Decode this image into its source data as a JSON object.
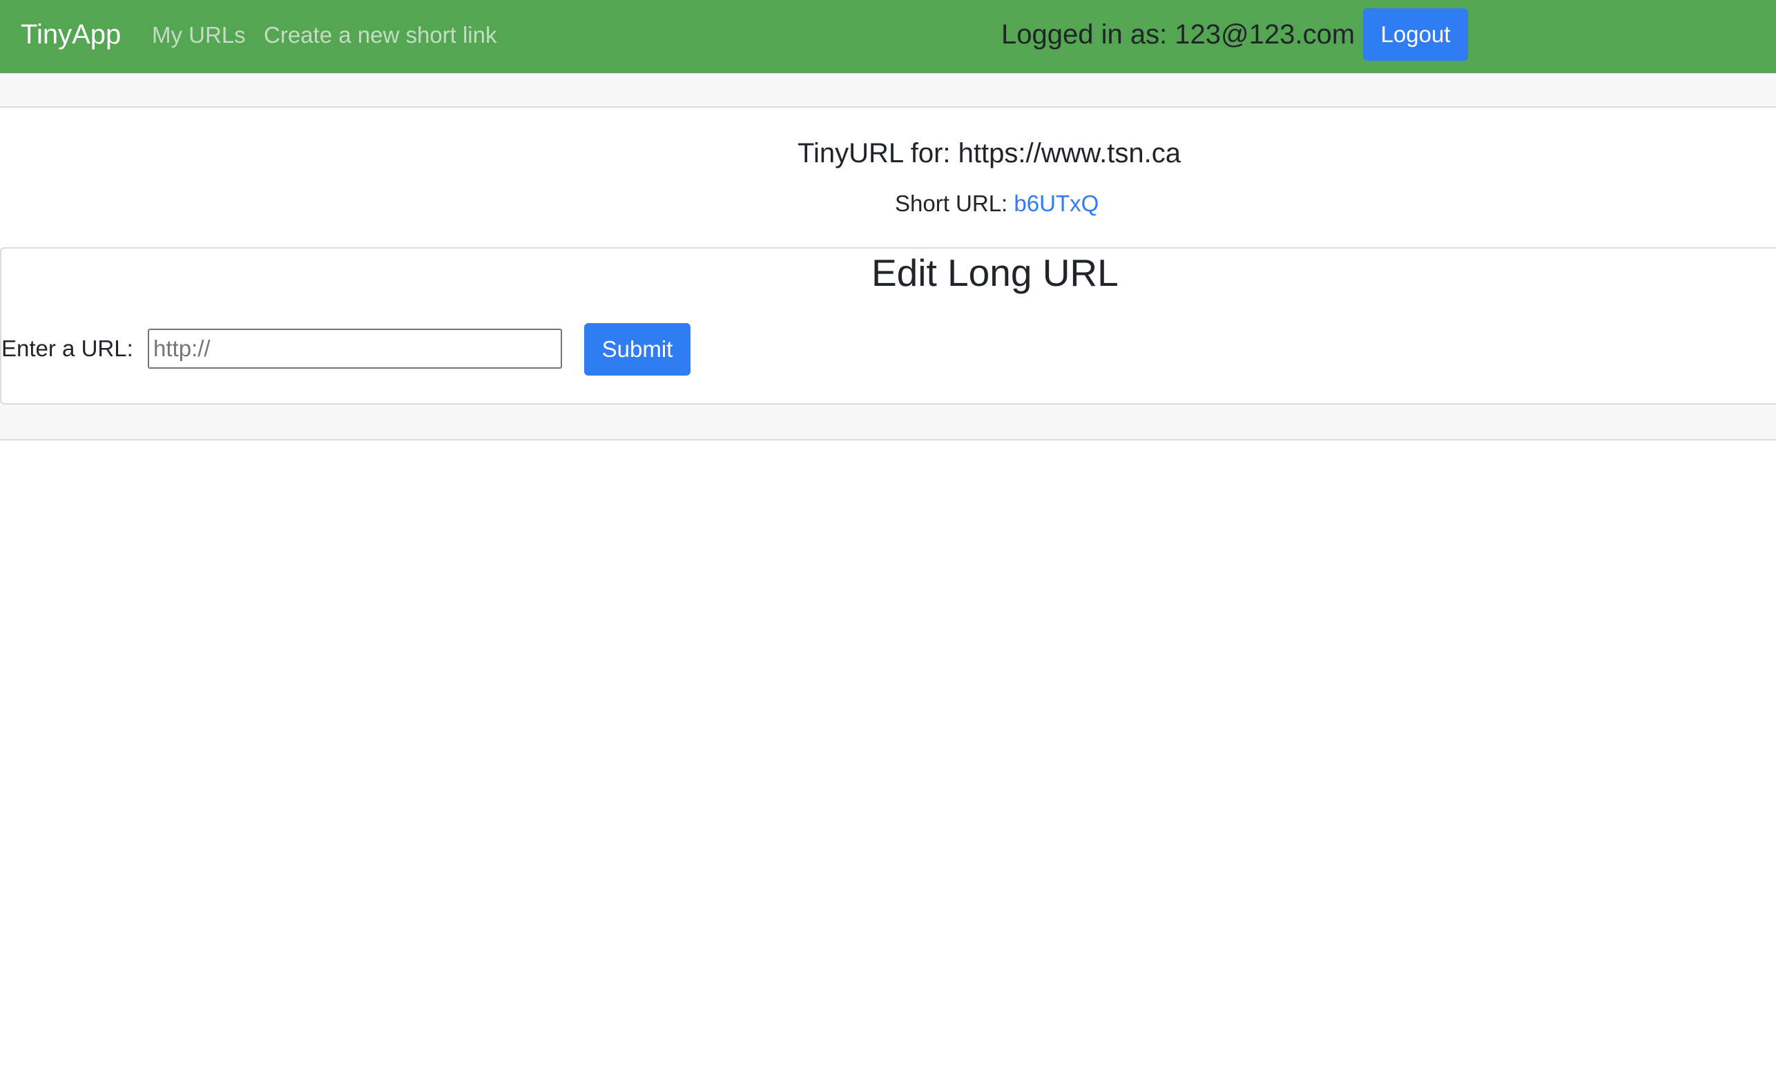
{
  "window": {
    "title": "TinyApp"
  },
  "navbar": {
    "brand": "TinyApp",
    "links": [
      {
        "label": "My URLs"
      },
      {
        "label": "Create a new short link"
      }
    ],
    "logged_in_text": "Logged in as: 123@123.com",
    "logout_label": "Logout",
    "background_color": "#55a653"
  },
  "url_info": {
    "title": "TinyURL for: https://www.tsn.ca",
    "short_url_label": "Short URL: ",
    "short_url_value": "b6UTxQ"
  },
  "edit_form": {
    "heading": "Edit Long URL",
    "input_label": "Enter a URL:",
    "input_placeholder": "http://",
    "input_value": "",
    "submit_label": "Submit"
  },
  "colors": {
    "primary_button": "#2f7cf3",
    "link": "#2f7cf3",
    "navbar": "#55a653"
  }
}
